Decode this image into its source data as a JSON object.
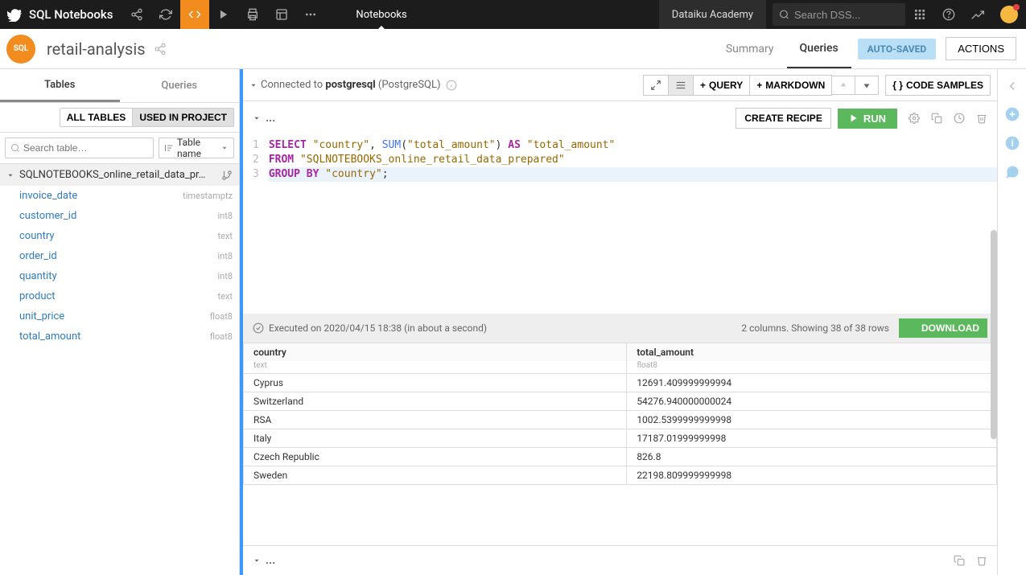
{
  "topbar": {
    "app_title": "SQL Notebooks",
    "notebooks_tab": "Notebooks",
    "academy": "Dataiku Academy",
    "search_placeholder": "Search DSS..."
  },
  "header": {
    "badge": "SQL",
    "title": "retail-analysis",
    "tabs": {
      "summary": "Summary",
      "queries": "Queries"
    },
    "autosaved": "AUTO-SAVED",
    "actions": "ACTIONS"
  },
  "sidebar": {
    "tabs": {
      "tables": "Tables",
      "queries": "Queries"
    },
    "filters": {
      "all": "ALL TABLES",
      "used": "USED IN PROJECT"
    },
    "search_placeholder": "Search table…",
    "sort_label": "Table name",
    "table_name": "SQLNOTEBOOKS_online_retail_data_pr…",
    "columns": [
      {
        "name": "invoice_date",
        "type": "timestamptz"
      },
      {
        "name": "customer_id",
        "type": "int8"
      },
      {
        "name": "country",
        "type": "text"
      },
      {
        "name": "order_id",
        "type": "int8"
      },
      {
        "name": "quantity",
        "type": "int8"
      },
      {
        "name": "product",
        "type": "text"
      },
      {
        "name": "unit_price",
        "type": "float8"
      },
      {
        "name": "total_amount",
        "type": "float8"
      }
    ]
  },
  "content": {
    "connected_prefix": "Connected to ",
    "connected_db": "postgresql",
    "connected_suffix": " (PostgreSQL)",
    "toolbar": {
      "query": "QUERY",
      "markdown": "MARKDOWN",
      "code_samples": "CODE SAMPLES"
    },
    "cell": {
      "dots": "...",
      "create_recipe": "CREATE RECIPE",
      "run": "RUN"
    },
    "code_lines": [
      "1",
      "2",
      "3"
    ],
    "result": {
      "executed": "Executed on 2020/04/15 18:38 (in about a second)",
      "summary": "2 columns. Showing 38 of 38 rows",
      "download": "DOWNLOAD",
      "headers": {
        "country": "country",
        "total": "total_amount"
      },
      "types": {
        "country": "text",
        "total": "float8"
      },
      "rows": [
        {
          "country": "Cyprus",
          "total": "12691.409999999994"
        },
        {
          "country": "Switzerland",
          "total": "54276.940000000024"
        },
        {
          "country": "RSA",
          "total": "1002.5399999999998"
        },
        {
          "country": "Italy",
          "total": "17187.01999999998"
        },
        {
          "country": "Czech Republic",
          "total": "826.8"
        },
        {
          "country": "Sweden",
          "total": "22198.809999999998"
        }
      ]
    }
  }
}
